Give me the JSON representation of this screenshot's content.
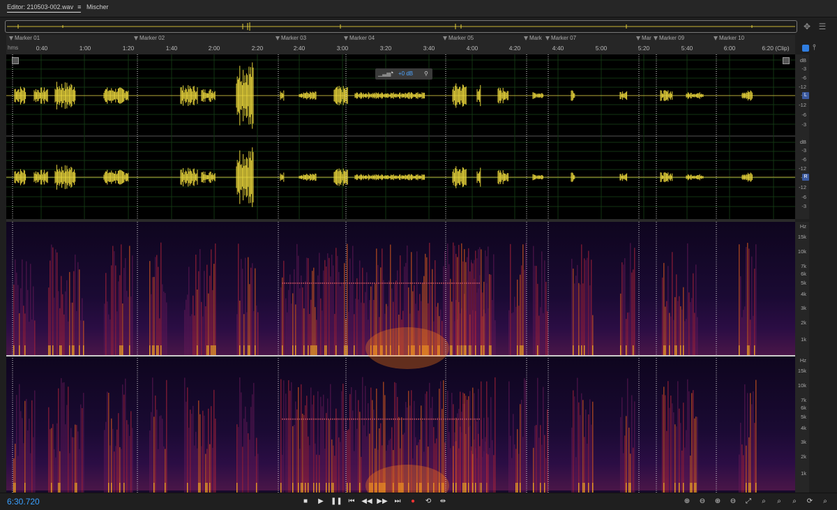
{
  "tabs": [
    {
      "label": "Editor: 210503-002.wav",
      "active": true
    },
    {
      "label": "Mischer",
      "active": false
    }
  ],
  "markers": [
    "Marker 01",
    "Marker 02",
    "Marker 03",
    "Marker 04",
    "Marker 05",
    "Mark",
    "Marker 07",
    "Mar",
    "Marker 09",
    "Marker 10"
  ],
  "ruler": {
    "unit": "hms",
    "ticks": [
      "0:40",
      "1:00",
      "1:20",
      "1:40",
      "2:00",
      "2:20",
      "2:40",
      "3:00",
      "3:20",
      "3:40",
      "4:00",
      "4:20",
      "4:40",
      "5:00",
      "5:20",
      "5:40",
      "6:00",
      "6:20 (Clip)"
    ]
  },
  "waveform": {
    "db_labels": [
      "dB",
      "-3",
      "-6",
      "-12",
      "-∞",
      "-12",
      "-6",
      "-3"
    ],
    "channels": [
      "L",
      "R"
    ],
    "color": "#e6d23a"
  },
  "spectral": {
    "hz_labels": [
      "Hz",
      "15k",
      "10k",
      "7k",
      "6k",
      "5k",
      "4k",
      "3k",
      "2k",
      "1k"
    ]
  },
  "hud": {
    "gain": "+0 dB"
  },
  "transport": {
    "time": "6:30.720"
  },
  "icons": {
    "transport": [
      "stop-icon",
      "play-icon",
      "pause-icon",
      "go-to-start-icon",
      "rewind-icon",
      "fast-forward-icon",
      "go-to-end-icon",
      "record-icon",
      "loop-icon",
      "skip-selection-icon"
    ],
    "zoom": [
      "zoom-in-amplitude-icon",
      "zoom-out-amplitude-icon",
      "zoom-in-time-icon",
      "zoom-out-time-icon",
      "zoom-out-full-icon",
      "zoom-in-start-icon",
      "zoom-in-end-icon",
      "zoom-in-selection-icon",
      "zoom-selection-icon",
      "zoom-reset-icon"
    ]
  }
}
